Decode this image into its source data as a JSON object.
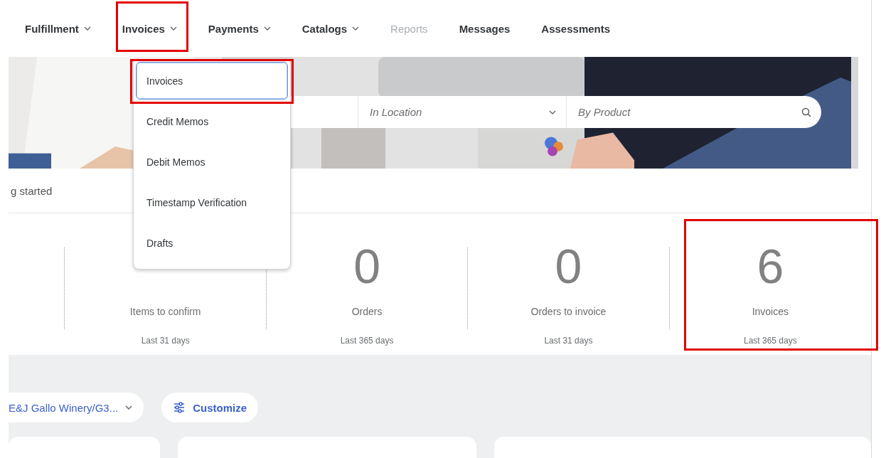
{
  "nav": [
    {
      "label": "Fulfillment",
      "has_menu": true,
      "disabled": false,
      "highlighted": false
    },
    {
      "label": "Invoices",
      "has_menu": true,
      "disabled": false,
      "highlighted": true
    },
    {
      "label": "Payments",
      "has_menu": true,
      "disabled": false,
      "highlighted": false
    },
    {
      "label": "Catalogs",
      "has_menu": true,
      "disabled": false,
      "highlighted": false
    },
    {
      "label": "Reports",
      "has_menu": false,
      "disabled": true,
      "highlighted": false
    },
    {
      "label": "Messages",
      "has_menu": false,
      "disabled": false,
      "highlighted": false
    },
    {
      "label": "Assessments",
      "has_menu": false,
      "disabled": false,
      "highlighted": false
    }
  ],
  "dropdown": {
    "items": [
      {
        "label": "Invoices",
        "selected": true,
        "highlighted": true
      },
      {
        "label": "Credit Memos",
        "selected": false,
        "highlighted": false
      },
      {
        "label": "Debit Memos",
        "selected": false,
        "highlighted": false
      },
      {
        "label": "Timestamp Verification",
        "selected": false,
        "highlighted": false
      },
      {
        "label": "Drafts",
        "selected": false,
        "highlighted": false
      }
    ]
  },
  "hero": {
    "search": {
      "location_placeholder": "In Location",
      "product_placeholder": "By Product"
    }
  },
  "getting_started": "g started",
  "stats": [
    {
      "label": "Items to confirm",
      "period": "Last 31 days",
      "highlighted": false
    },
    {
      "value": "0",
      "label": "Orders",
      "period": "Last 365 days",
      "highlighted": false
    },
    {
      "value": "0",
      "label": "Orders to invoice",
      "period": "Last 31 days",
      "highlighted": false
    },
    {
      "value": "6",
      "label": "Invoices",
      "period": "Last 365 days",
      "highlighted": true
    }
  ],
  "filters": {
    "customer": "E&J Gallo Winery/G3...",
    "customize": "Customize"
  }
}
